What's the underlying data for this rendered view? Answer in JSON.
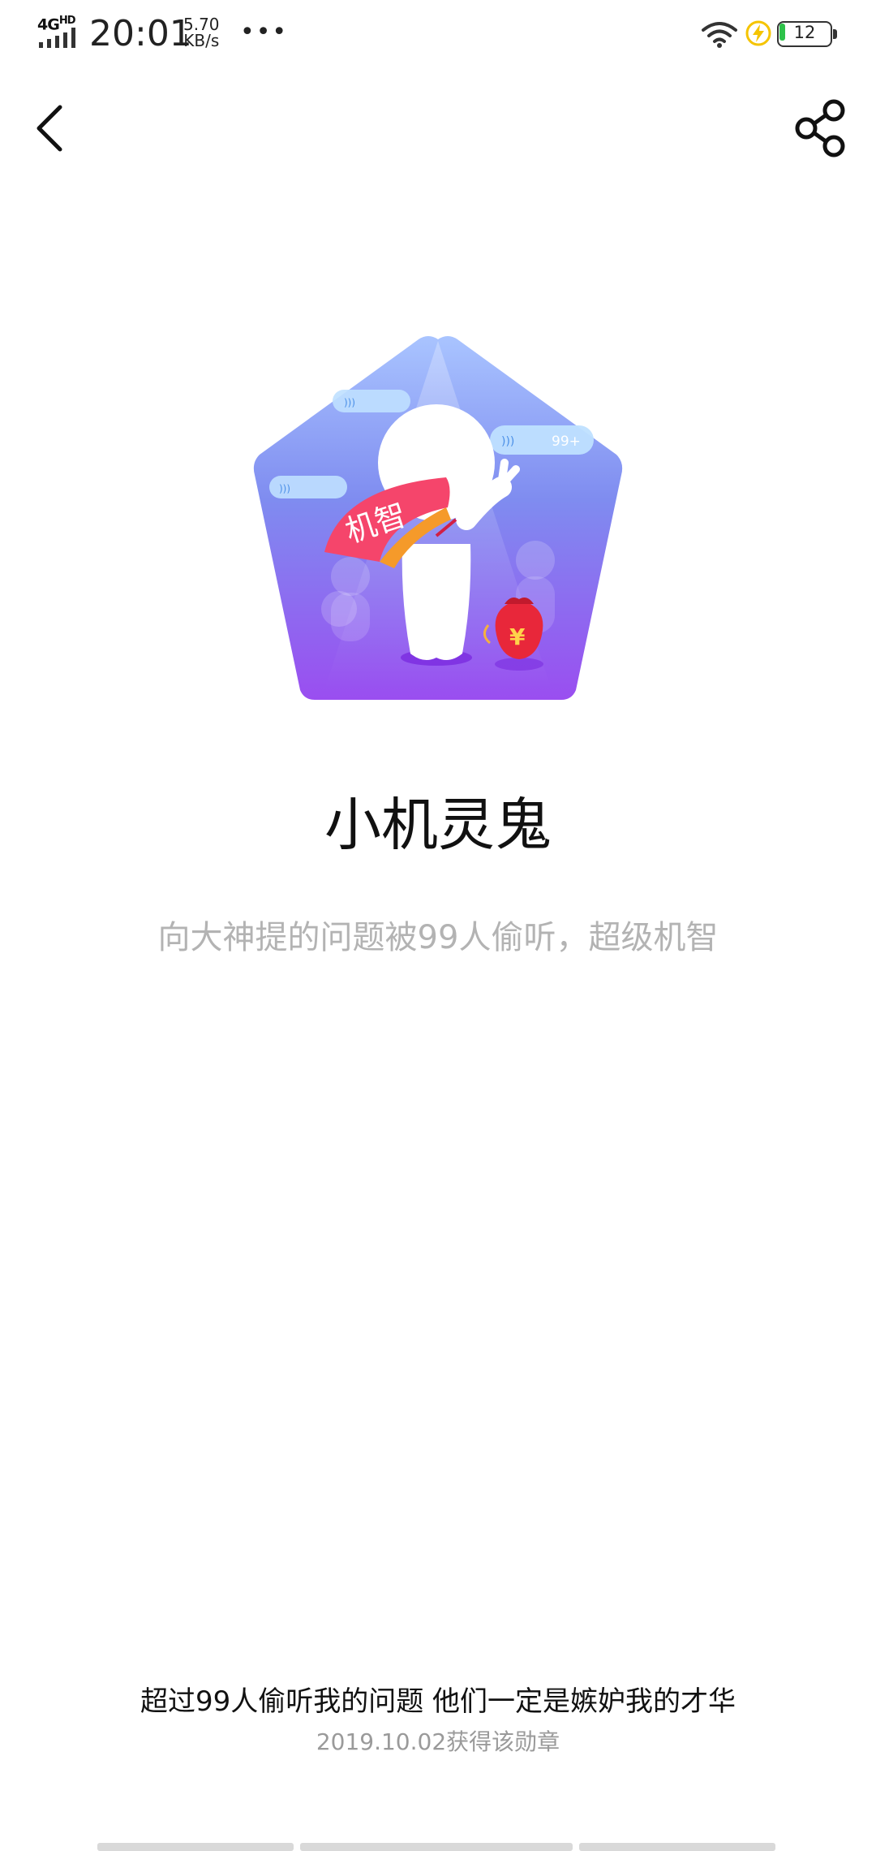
{
  "status_bar": {
    "network": "4G",
    "network_sup": "HD",
    "time": "20:01",
    "speed_value": "5.70",
    "speed_unit": "KB/s",
    "more": "•••",
    "battery": "12",
    "battery_level": 0.12,
    "battery_color": "#2ec24a",
    "charging_color": "#f5c400"
  },
  "header": {
    "back_icon": "chevron-left-icon",
    "share_icon": "share-icon"
  },
  "badge": {
    "fan_text": "机智",
    "bubble_count": "99+",
    "money_symbol": "¥",
    "colors": {
      "gradient_top": "#a9c4ff",
      "gradient_bottom": "#9a4ef0",
      "fan": "#f5456b",
      "bag": "#e8273a"
    }
  },
  "title": "小机灵鬼",
  "description": "向大神提的问题被99人偷听，超级机智",
  "quote": "超过99人偷听我的问题 他们一定是嫉妒我的才华",
  "earned": "2019.10.02获得该勋章"
}
